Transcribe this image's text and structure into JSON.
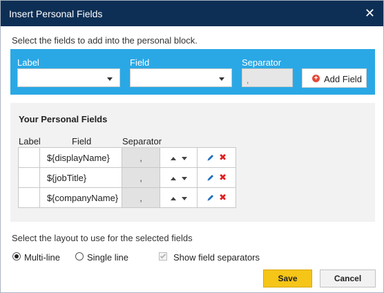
{
  "dialog": {
    "title": "Insert Personal Fields",
    "close_glyph": "✕",
    "instruction": "Select the fields to add into the personal block."
  },
  "add_bar": {
    "label_header": "Label",
    "field_header": "Field",
    "separator_header": "Separator",
    "label_value": "",
    "field_value": "",
    "separator_value": ",",
    "add_button": "Add Field",
    "add_icon": "plus-circle-icon",
    "background_color": "#2aa8e5"
  },
  "personal_fields": {
    "heading": "Your Personal Fields",
    "columns": [
      "Label",
      "Field",
      "Separator"
    ],
    "rows": [
      {
        "label": "",
        "field": "${displayName}",
        "separator": ","
      },
      {
        "label": "",
        "field": "${jobTitle}",
        "separator": ","
      },
      {
        "label": "",
        "field": "${companyName}",
        "separator": ","
      }
    ]
  },
  "layout": {
    "prompt": "Select the layout to use for the selected fields",
    "options": [
      {
        "label": "Multi-line",
        "selected": true
      },
      {
        "label": "Single line",
        "selected": false
      }
    ],
    "show_separators_label": "Show field separators",
    "show_separators_checked": true,
    "show_separators_disabled": true
  },
  "footer": {
    "save": "Save",
    "cancel": "Cancel",
    "save_color": "#f5c518"
  }
}
